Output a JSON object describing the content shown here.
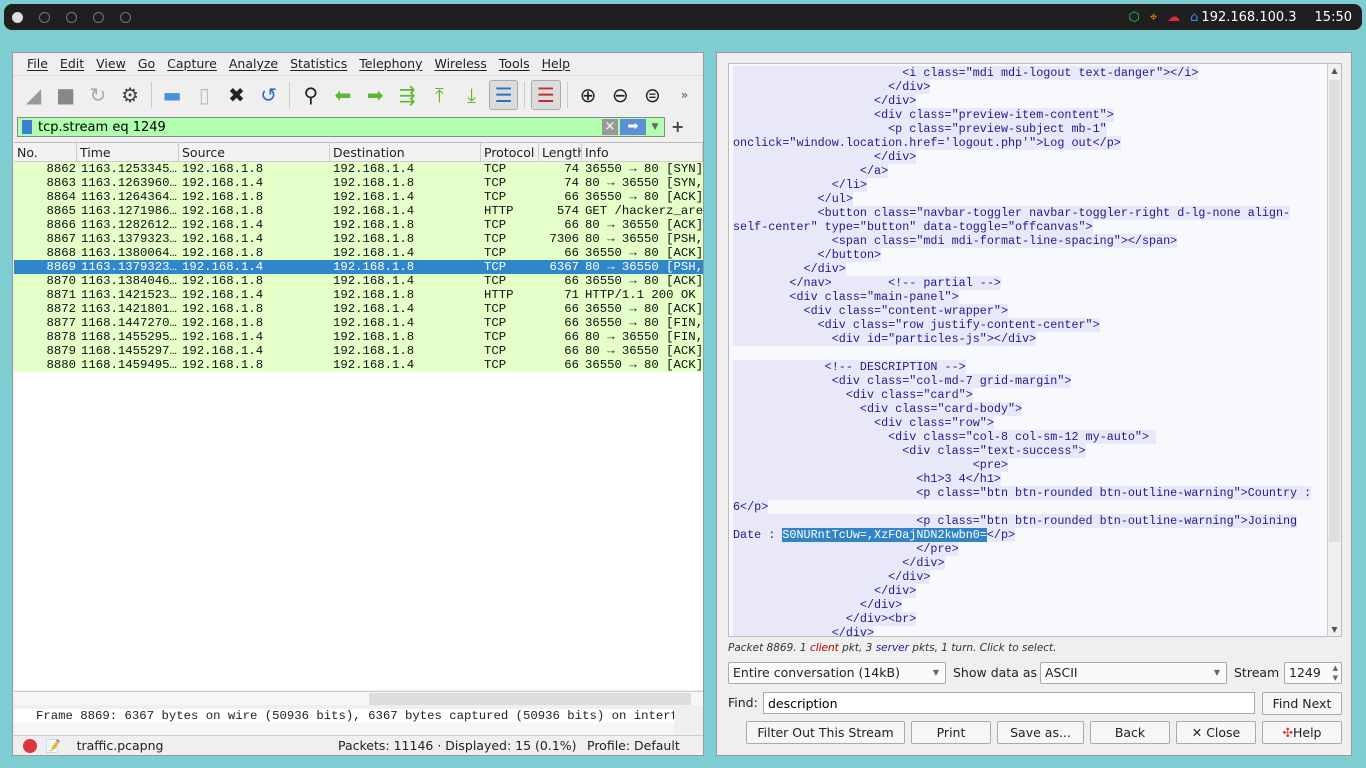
{
  "topbar": {
    "ip": "192.168.100.3",
    "time": "15:50",
    "icons": [
      "cube-icon",
      "crosshair-icon",
      "cloud-icon",
      "home-icon"
    ]
  },
  "menu": [
    "File",
    "Edit",
    "View",
    "Go",
    "Capture",
    "Analyze",
    "Statistics",
    "Telephony",
    "Wireless",
    "Tools",
    "Help"
  ],
  "filter": {
    "value": "tcp.stream eq 1249"
  },
  "columns": [
    "No.",
    "Time",
    "Source",
    "Destination",
    "Protocol",
    "Length",
    "Info"
  ],
  "packets": [
    [
      "8862",
      "1163.1253345…",
      "192.168.1.8",
      "192.168.1.4",
      "TCP",
      "74",
      "36550 → 80 [SYN]"
    ],
    [
      "8863",
      "1163.1263960…",
      "192.168.1.4",
      "192.168.1.8",
      "TCP",
      "74",
      "80 → 36550 [SYN,"
    ],
    [
      "8864",
      "1163.1264364…",
      "192.168.1.8",
      "192.168.1.4",
      "TCP",
      "66",
      "36550 → 80 [ACK]"
    ],
    [
      "8865",
      "1163.1271986…",
      "192.168.1.8",
      "192.168.1.4",
      "HTTP",
      "574",
      "GET /hackerz_are"
    ],
    [
      "8866",
      "1163.1282612…",
      "192.168.1.4",
      "192.168.1.8",
      "TCP",
      "66",
      "80 → 36550 [ACK]"
    ],
    [
      "8867",
      "1163.1379323…",
      "192.168.1.4",
      "192.168.1.8",
      "TCP",
      "7306",
      "80 → 36550 [PSH,"
    ],
    [
      "8868",
      "1163.1380064…",
      "192.168.1.8",
      "192.168.1.4",
      "TCP",
      "66",
      "36550 → 80 [ACK]"
    ],
    [
      "8869",
      "1163.1379323…",
      "192.168.1.4",
      "192.168.1.8",
      "TCP",
      "6367",
      "80 → 36550 [PSH,"
    ],
    [
      "8870",
      "1163.1384046…",
      "192.168.1.8",
      "192.168.1.4",
      "TCP",
      "66",
      "36550 → 80 [ACK]"
    ],
    [
      "8871",
      "1163.1421523…",
      "192.168.1.4",
      "192.168.1.8",
      "HTTP",
      "71",
      "HTTP/1.1 200 OK"
    ],
    [
      "8872",
      "1163.1421801…",
      "192.168.1.8",
      "192.168.1.4",
      "TCP",
      "66",
      "36550 → 80 [ACK]"
    ],
    [
      "8877",
      "1168.1447270…",
      "192.168.1.8",
      "192.168.1.4",
      "TCP",
      "66",
      "36550 → 80 [FIN,"
    ],
    [
      "8878",
      "1168.1455295…",
      "192.168.1.4",
      "192.168.1.8",
      "TCP",
      "66",
      "80 → 36550 [FIN,"
    ],
    [
      "8879",
      "1168.1455297…",
      "192.168.1.4",
      "192.168.1.8",
      "TCP",
      "66",
      "80 → 36550 [ACK]"
    ],
    [
      "8880",
      "1168.1459495…",
      "192.168.1.8",
      "192.168.1.4",
      "TCP",
      "66",
      "36550 → 80 [ACK]"
    ]
  ],
  "selected_packet": "8869",
  "detail": "Frame 8869: 6367 bytes on wire (50936 bits), 6367 bytes captured (50936 bits) on interfa",
  "status": {
    "file": "traffic.pcapng",
    "packets": "Packets: 11146 · Displayed: 15 (0.1%)",
    "profile": "Profile: Default"
  },
  "stream": {
    "lines": [
      "                        <i class=\"mdi mdi-logout text-danger\"></i>",
      "                      </div>",
      "                    </div>",
      "                    <div class=\"preview-item-content\">",
      "                      <p class=\"preview-subject mb-1\"",
      "onclick=\"window.location.href='logout.php'\">Log out</p>",
      "                    </div>",
      "                  </a>",
      "              </li>",
      "            </ul>",
      "            <button class=\"navbar-toggler navbar-toggler-right d-lg-none align-",
      "self-center\" type=\"button\" data-toggle=\"offcanvas\">",
      "              <span class=\"mdi mdi-format-line-spacing\"></span>",
      "            </button>",
      "          </div>",
      "        </nav>        <!-- partial -->",
      "        <div class=\"main-panel\">",
      "          <div class=\"content-wrapper\">",
      "            <div class=\"row justify-content-center\">",
      "              <div id=\"particles-js\"></div>",
      "",
      "             <!-- DESCRIPTION -->",
      "              <div class=\"col-md-7 grid-margin\">",
      "                <div class=\"card\">",
      "                  <div class=\"card-body\">",
      "                    <div class=\"row\">",
      "                      <div class=\"col-8 col-sm-12 my-auto\"> ",
      "                        <div class=\"text-success\">",
      "                                  <pre>",
      "                          <h1>3 4</h1>",
      "                          <p class=\"btn btn-rounded btn-outline-warning\">Country :",
      "6</p>",
      "                          <p class=\"btn btn-rounded btn-outline-warning\">Joining",
      {
        "pre": "Date : ",
        "sel": "S0NURntTcUw=,XzFOajNDN2kwbn0=",
        "post": "</p>"
      },
      "                          </pre>",
      "                        </div>",
      "                      </div>",
      "                    </div>",
      "                  </div>",
      "                </div><br>",
      "              </div>"
    ],
    "info": {
      "a": "Packet 8869. 1 ",
      "client": "client",
      "b": " pkt, 3 ",
      "server": "server",
      "c": " pkts, 1 turn. Click to select."
    },
    "conversation": "Entire conversation (14kB)",
    "show_label": "Show data as",
    "show_value": "ASCII",
    "stream_label": "Stream",
    "stream_value": "1249",
    "find_label": "Find:",
    "find_value": "description",
    "find_next": "Find Next",
    "buttons": {
      "filter_out": "Filter Out This Stream",
      "print": "Print",
      "save": "Save as...",
      "back": "Back",
      "close": "Close",
      "help": "Help"
    }
  },
  "colors": {
    "row_bg": "#e4ffc7",
    "selected": "#2f86c8",
    "filter_ok": "#afffaf",
    "server_text": "#1c1c8c",
    "server_bg": "#e8e8f8",
    "client": "#b00000"
  }
}
